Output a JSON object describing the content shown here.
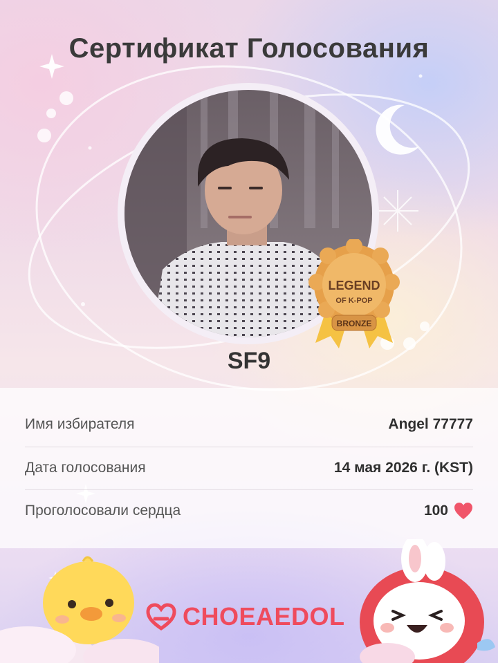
{
  "certificate": {
    "title": "Сертификат Голосования",
    "artist": "SF9"
  },
  "badge": {
    "line1": "LEGEND",
    "line2": "OF K-POP",
    "tier": "BRONZE"
  },
  "details": {
    "voter_label": "Имя избирателя",
    "voter_value": "Angel 77777",
    "date_label": "Дата голосования",
    "date_value": "14 мая 2026 г. (KST)",
    "hearts_label": "Проголосовали сердца",
    "hearts_value": "100"
  },
  "brand": {
    "name": "CHOEAEDOL"
  },
  "colors": {
    "brand_red": "#ef4b5d",
    "heart_red": "#f0556a",
    "badge_gold": "#e6a04a"
  },
  "icons": {
    "heart": "heart-icon",
    "moon": "crescent-moon-icon",
    "sparkle": "sparkle-icon"
  }
}
